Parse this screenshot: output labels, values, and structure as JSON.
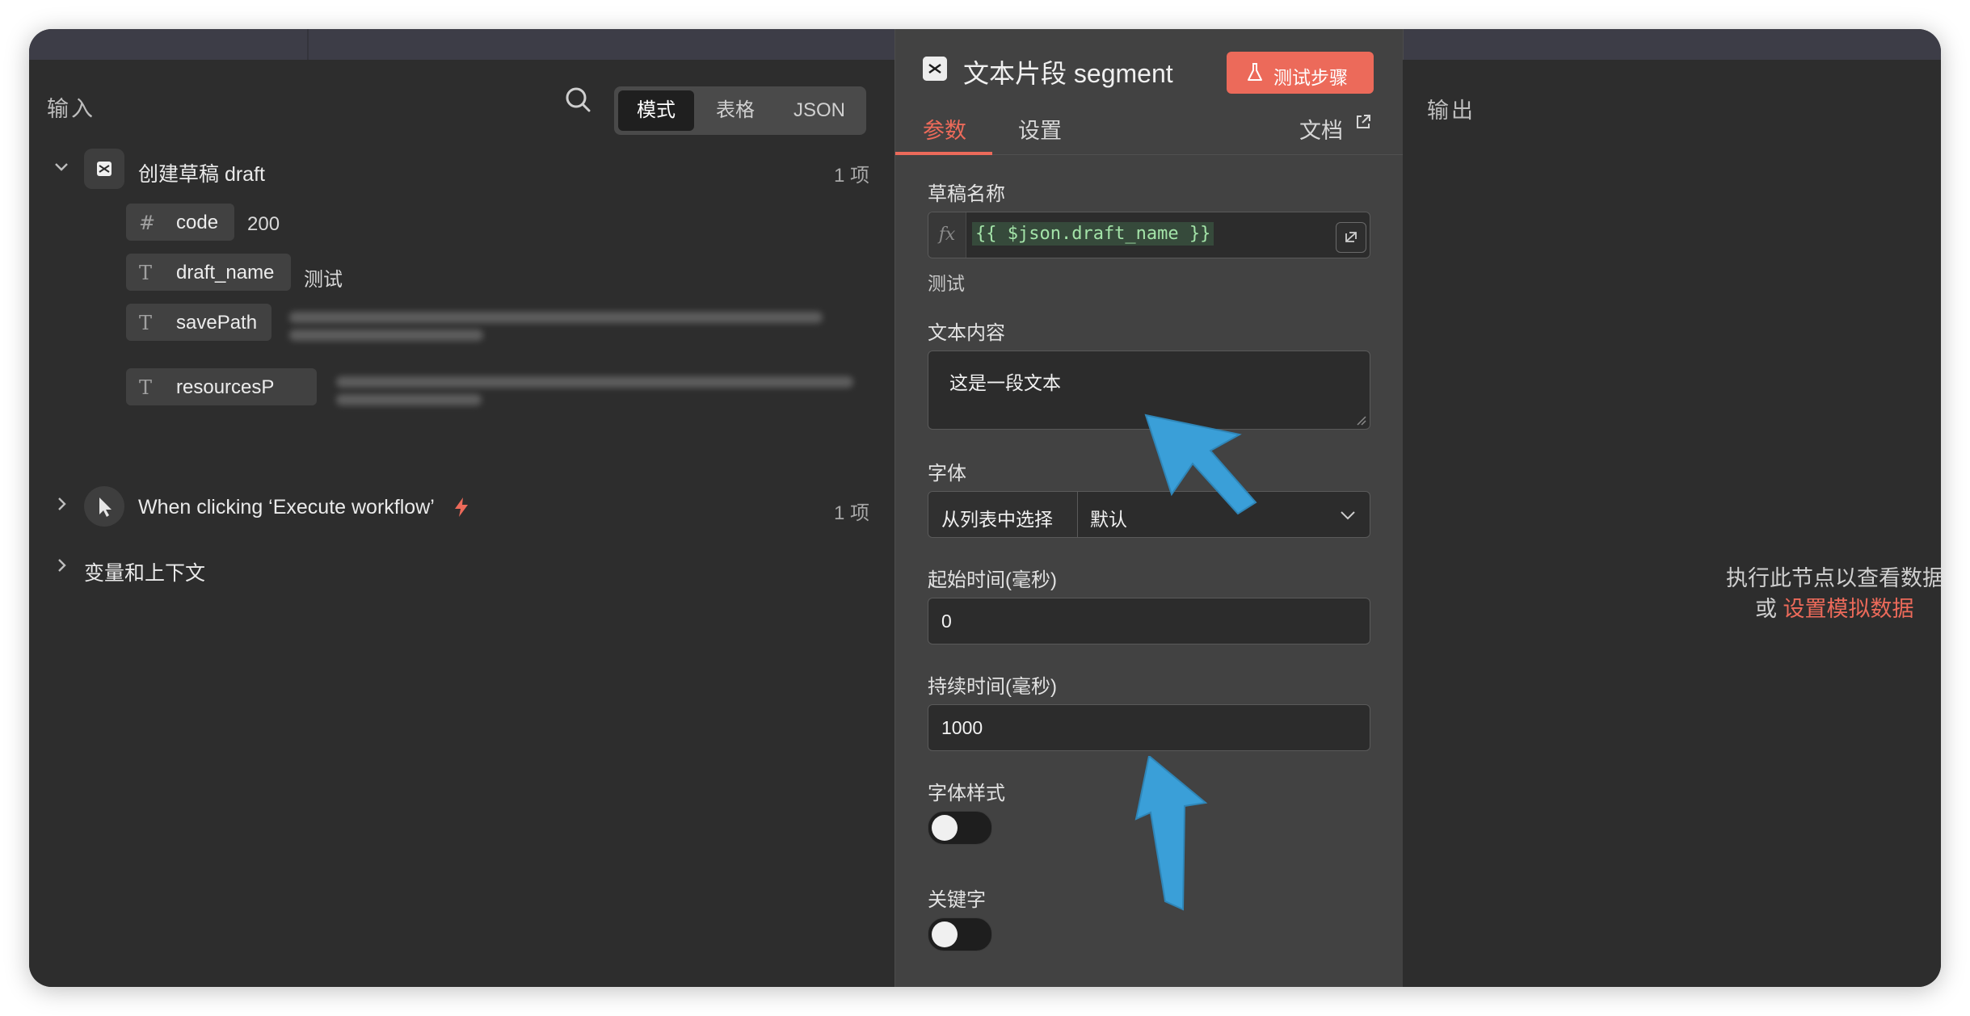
{
  "input_panel": {
    "title": "输入",
    "view_modes": [
      "模式",
      "表格",
      "JSON"
    ],
    "active_view": "模式",
    "nodes": [
      {
        "name": "创建草稿 draft",
        "count": "1 项",
        "expanded": true,
        "fields": [
          {
            "type_icon": "#",
            "name": "code",
            "value": "200"
          },
          {
            "type_icon": "T",
            "name": "draft_name",
            "value": "测试"
          },
          {
            "type_icon": "T",
            "name": "savePath",
            "value": ""
          },
          {
            "type_icon": "T",
            "name": "resourcesP",
            "value": ""
          }
        ]
      },
      {
        "name": "When clicking ‘Execute workflow’",
        "count": "1 项",
        "expanded": false
      }
    ],
    "variables_label": "变量和上下文"
  },
  "param_panel": {
    "title": "文本片段 segment",
    "test_button": "测试步骤",
    "tabs": [
      "参数",
      "设置"
    ],
    "active_tab": "参数",
    "docs_link": "文档",
    "fields": {
      "draft_name": {
        "label": "草稿名称",
        "fx": "fx",
        "expression": "{{ $json.draft_name }}",
        "hint": "测试"
      },
      "text_content": {
        "label": "文本内容",
        "value": "这是一段文本"
      },
      "font": {
        "label": "字体",
        "mode": "从列表中选择",
        "value": "默认"
      },
      "start_time": {
        "label": "起始时间(毫秒)",
        "value": "0"
      },
      "duration": {
        "label": "持续时间(毫秒)",
        "value": "1000"
      },
      "font_style": {
        "label": "字体样式",
        "on": false
      },
      "keyword": {
        "label": "关键字",
        "on": false
      }
    }
  },
  "output_panel": {
    "title": "输出",
    "empty_message": "执行此节点以查看数据",
    "or_label": "或",
    "mock_link": "设置模拟数据"
  },
  "colors": {
    "accent": "#ec6a5a",
    "panel_bg": "#2d2d2d",
    "param_bg": "#424242",
    "annotation_arrow": "#3a9fd8"
  }
}
